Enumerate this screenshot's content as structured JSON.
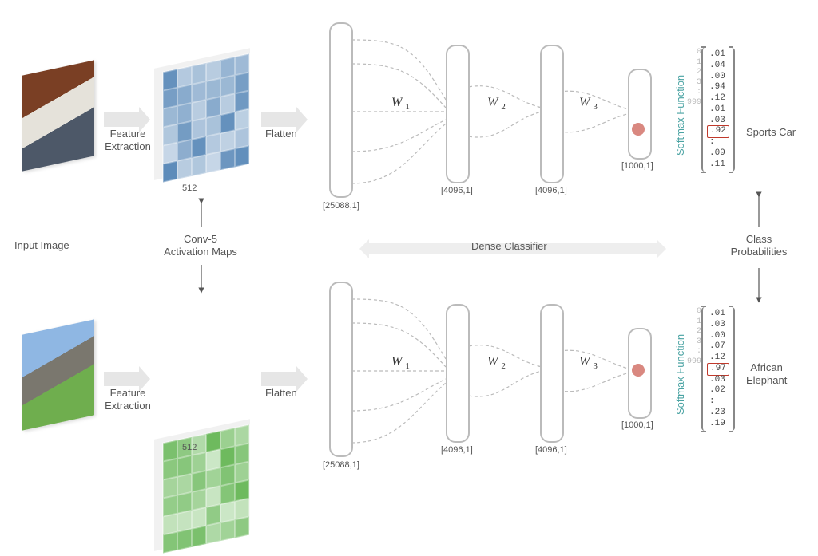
{
  "labels": {
    "input_image": "Input Image",
    "feature_extraction": "Feature\nExtraction",
    "conv5": "Conv-5\nActivation Maps",
    "flatten": "Flatten",
    "dense_classifier": "Dense Classifier",
    "class_probs": "Class\nProbabilities",
    "softmax": "Softmax Function",
    "depth_512": "512",
    "flat_dim": "[25088,1]",
    "h1_dim": "[4096,1]",
    "h2_dim": "[4096,1]",
    "out_dim": "[1000,1]",
    "w1": "W",
    "w1s": "1",
    "w2": "W",
    "w2s": "2",
    "w3": "W",
    "w3s": "3",
    "top_class": "Sports Car",
    "bot_class": "African\nElephant"
  },
  "output_top": {
    "indices": [
      "0",
      "1",
      "2",
      "3",
      " ",
      " ",
      " ",
      " ",
      ":",
      " ",
      "999"
    ],
    "values": [
      ".01",
      ".04",
      ".00",
      ".94",
      ".12",
      ".01",
      ".03",
      ".92",
      ":",
      ".09",
      ".11"
    ],
    "highlight_index": 7
  },
  "output_bottom": {
    "indices": [
      "0",
      "1",
      "2",
      "3",
      " ",
      " ",
      " ",
      " ",
      " ",
      ":",
      "999"
    ],
    "values": [
      ".01",
      ".03",
      ".00",
      ".07",
      ".12",
      ".97",
      ".03",
      ".02",
      ":",
      ".23",
      ".19"
    ],
    "highlight_index": 5
  }
}
